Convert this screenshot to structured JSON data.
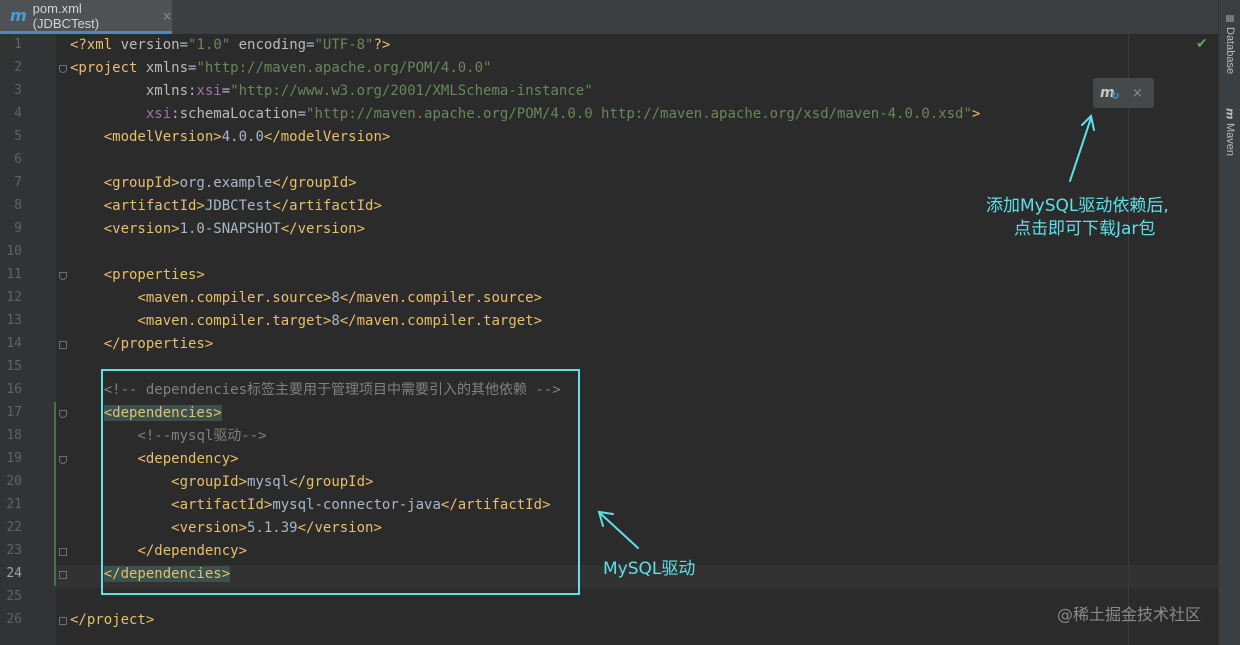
{
  "tab": {
    "icon": "maven-icon",
    "title": "pom.xml (JDBCTest)",
    "close": "×"
  },
  "sidebar": [
    {
      "icon": "database-icon",
      "glyph": "≣",
      "label": "Database"
    },
    {
      "icon": "maven-icon",
      "glyph": "m",
      "label": "Maven"
    }
  ],
  "status": {
    "check": "✔"
  },
  "maven_popup": {
    "icon": "maven-reload-icon",
    "glyph": "m",
    "sync": "↻",
    "close": "×"
  },
  "current_line": 24,
  "code_lines": [
    [
      [
        "t",
        "<?xml "
      ],
      [
        "an",
        "version"
      ],
      [
        "tx",
        "="
      ],
      [
        "av",
        "\"1.0\""
      ],
      [
        "an",
        " encoding"
      ],
      [
        "tx",
        "="
      ],
      [
        "av",
        "\"UTF-8\""
      ],
      [
        "t",
        "?>"
      ]
    ],
    [
      [
        "t",
        "<project "
      ],
      [
        "an",
        "xmlns"
      ],
      [
        "tx",
        "="
      ],
      [
        "av",
        "\"http://maven.apache.org/POM/4.0.0\""
      ]
    ],
    [
      [
        "tx",
        "         "
      ],
      [
        "an",
        "xmlns"
      ],
      [
        "tx",
        ":"
      ],
      [
        "ns",
        "xsi"
      ],
      [
        "tx",
        "="
      ],
      [
        "av",
        "\"http://www.w3.org/2001/XMLSchema-instance\""
      ]
    ],
    [
      [
        "tx",
        "         "
      ],
      [
        "ns",
        "xsi"
      ],
      [
        "tx",
        ":"
      ],
      [
        "an",
        "schemaLocation"
      ],
      [
        "tx",
        "="
      ],
      [
        "av",
        "\"http://maven.apache.org/POM/4.0.0 http://maven.apache.org/xsd/maven-4.0.0.xsd\""
      ],
      [
        "t",
        ">"
      ]
    ],
    [
      [
        "tx",
        "    "
      ],
      [
        "t",
        "<modelVersion>"
      ],
      [
        "tx",
        "4.0.0"
      ],
      [
        "t",
        "</modelVersion>"
      ]
    ],
    [],
    [
      [
        "tx",
        "    "
      ],
      [
        "t",
        "<groupId>"
      ],
      [
        "tx",
        "org.example"
      ],
      [
        "t",
        "</groupId>"
      ]
    ],
    [
      [
        "tx",
        "    "
      ],
      [
        "t",
        "<artifactId>"
      ],
      [
        "tx",
        "JDBCTest"
      ],
      [
        "t",
        "</artifactId>"
      ]
    ],
    [
      [
        "tx",
        "    "
      ],
      [
        "t",
        "<version>"
      ],
      [
        "tx",
        "1.0-SNAPSHOT"
      ],
      [
        "t",
        "</version>"
      ]
    ],
    [],
    [
      [
        "tx",
        "    "
      ],
      [
        "t",
        "<properties>"
      ]
    ],
    [
      [
        "tx",
        "        "
      ],
      [
        "t",
        "<maven.compiler.source>"
      ],
      [
        "tx",
        "8"
      ],
      [
        "t",
        "</maven.compiler.source>"
      ]
    ],
    [
      [
        "tx",
        "        "
      ],
      [
        "t",
        "<maven.compiler.target>"
      ],
      [
        "tx",
        "8"
      ],
      [
        "t",
        "</maven.compiler.target>"
      ]
    ],
    [
      [
        "tx",
        "    "
      ],
      [
        "t",
        "</properties>"
      ]
    ],
    [],
    [
      [
        "tx",
        "    "
      ],
      [
        "cm",
        "<!-- dependencies标签主要用于管理项目中需要引入的其他依赖 -->"
      ]
    ],
    [
      [
        "tx",
        "    "
      ],
      [
        "t hl",
        "<dependencies>"
      ]
    ],
    [
      [
        "tx",
        "        "
      ],
      [
        "cm",
        "<!--mysql驱动-->"
      ]
    ],
    [
      [
        "tx",
        "        "
      ],
      [
        "t",
        "<dependency>"
      ]
    ],
    [
      [
        "tx",
        "            "
      ],
      [
        "t",
        "<groupId>"
      ],
      [
        "tx",
        "mysql"
      ],
      [
        "t",
        "</groupId>"
      ]
    ],
    [
      [
        "tx",
        "            "
      ],
      [
        "t",
        "<artifactId>"
      ],
      [
        "tx",
        "mysql-connector-java"
      ],
      [
        "t",
        "</artifactId>"
      ]
    ],
    [
      [
        "tx",
        "            "
      ],
      [
        "t",
        "<version>"
      ],
      [
        "tx",
        "5.1.39"
      ],
      [
        "t",
        "</version>"
      ]
    ],
    [
      [
        "tx",
        "        "
      ],
      [
        "t",
        "</dependency>"
      ]
    ],
    [
      [
        "tx",
        "    "
      ],
      [
        "t hl",
        "</dependencies>"
      ]
    ],
    [],
    [
      [
        "t",
        "</project>"
      ]
    ]
  ],
  "annotations": {
    "top_line1": "添加MySQL驱动依赖后,",
    "top_line2": "点击即可下载Jar包",
    "driver": "MySQL驱动"
  },
  "watermark": "@稀土掘金技术社区",
  "colors": {
    "accent_cyan": "#5ee0e8",
    "tag": "#e8bf6a",
    "attr_value": "#6a8759",
    "comment": "#808080"
  }
}
